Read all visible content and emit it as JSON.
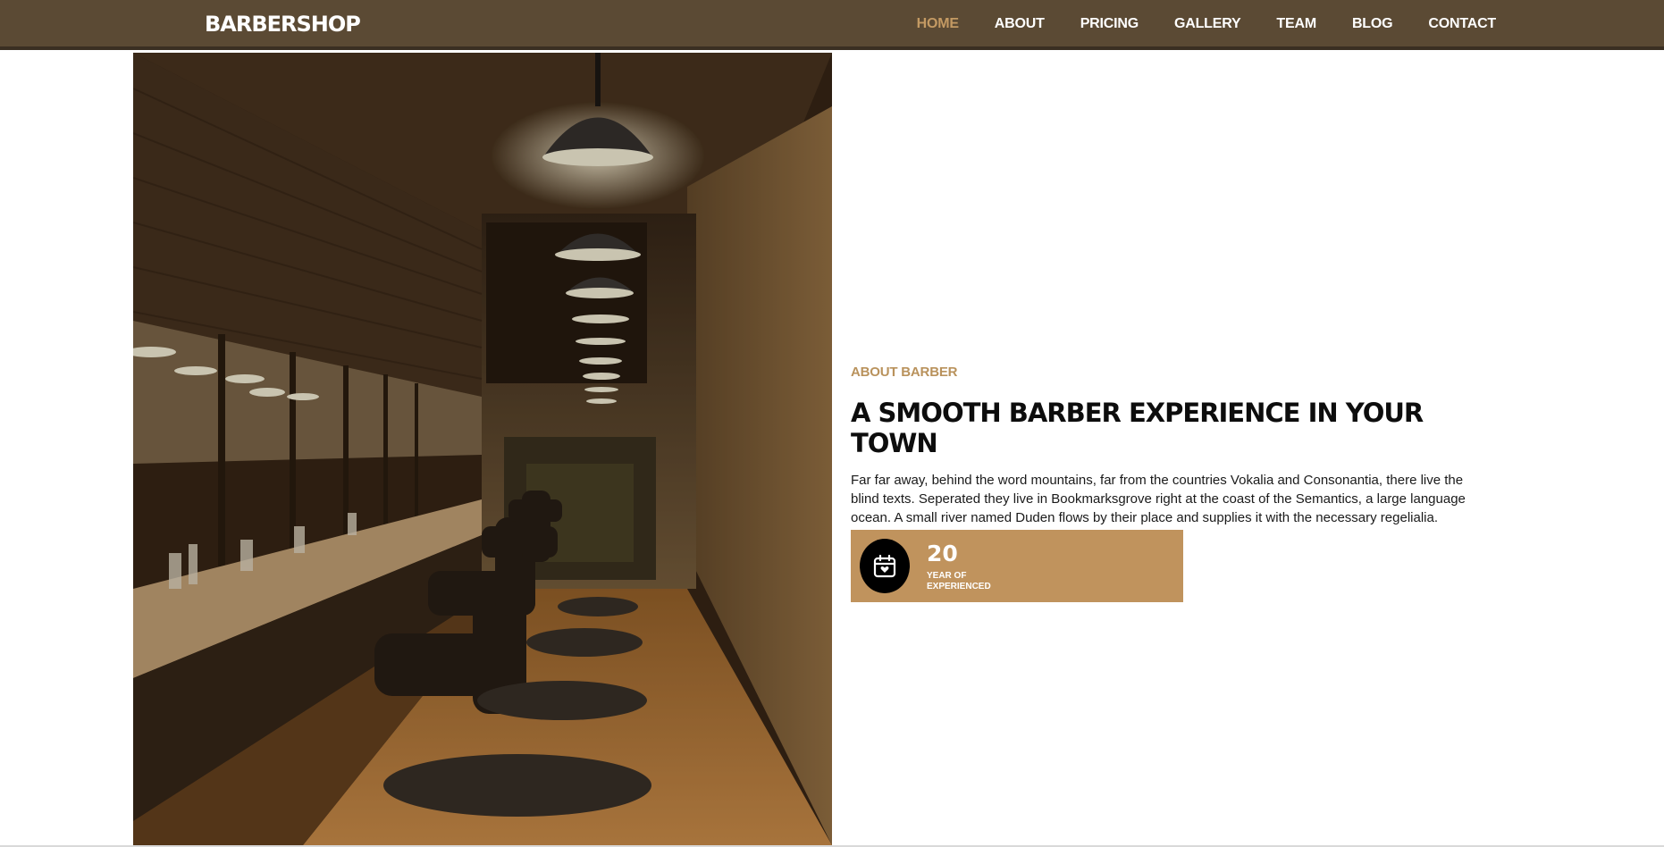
{
  "header": {
    "brand": "BARBERSHOP",
    "nav": [
      {
        "label": "HOME",
        "active": true
      },
      {
        "label": "ABOUT",
        "active": false
      },
      {
        "label": "PRICING",
        "active": false
      },
      {
        "label": "GALLERY",
        "active": false
      },
      {
        "label": "TEAM",
        "active": false
      },
      {
        "label": "BLOG",
        "active": false
      },
      {
        "label": "CONTACT",
        "active": false
      }
    ]
  },
  "about": {
    "subheading": "ABOUT BARBER",
    "headline": "A SMOOTH BARBER EXPERIENCE IN YOUR TOWN",
    "description": "Far far away, behind the word mountains, far from the countries Vokalia and Consonantia, there live the blind texts. Seperated they live in Bookmarksgrove right at the coast of the Semantics, a large language ocean. A small river named Duden flows by their place and supplies it with the necessary regelialia.",
    "stat": {
      "icon": "calendar-heart-icon",
      "number": "20",
      "label_line1": "YEAR OF",
      "label_line2": "EXPERIENCED"
    }
  },
  "colors": {
    "nav_bg": "#5b4a34",
    "accent": "#c0935d",
    "active_link": "#c49a63"
  }
}
